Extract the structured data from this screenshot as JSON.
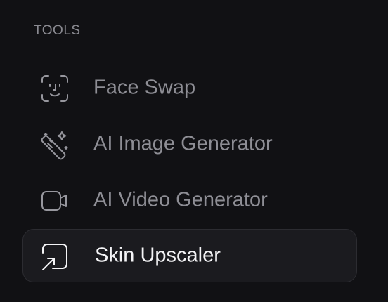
{
  "sidebar": {
    "section_title": "TOOLS",
    "items": [
      {
        "label": "Face Swap",
        "icon": "face-scan-icon",
        "active": false
      },
      {
        "label": "AI Image Generator",
        "icon": "magic-wand-icon",
        "active": false
      },
      {
        "label": "AI Video Generator",
        "icon": "video-camera-icon",
        "active": false
      },
      {
        "label": "Skin Upscaler",
        "icon": "upscale-icon",
        "active": true
      }
    ]
  },
  "colors": {
    "background": "#111114",
    "active_background": "#1b1b1f",
    "active_border": "#2c2c31",
    "muted_text": "#8e8e95",
    "active_text": "#f4f4f6"
  }
}
